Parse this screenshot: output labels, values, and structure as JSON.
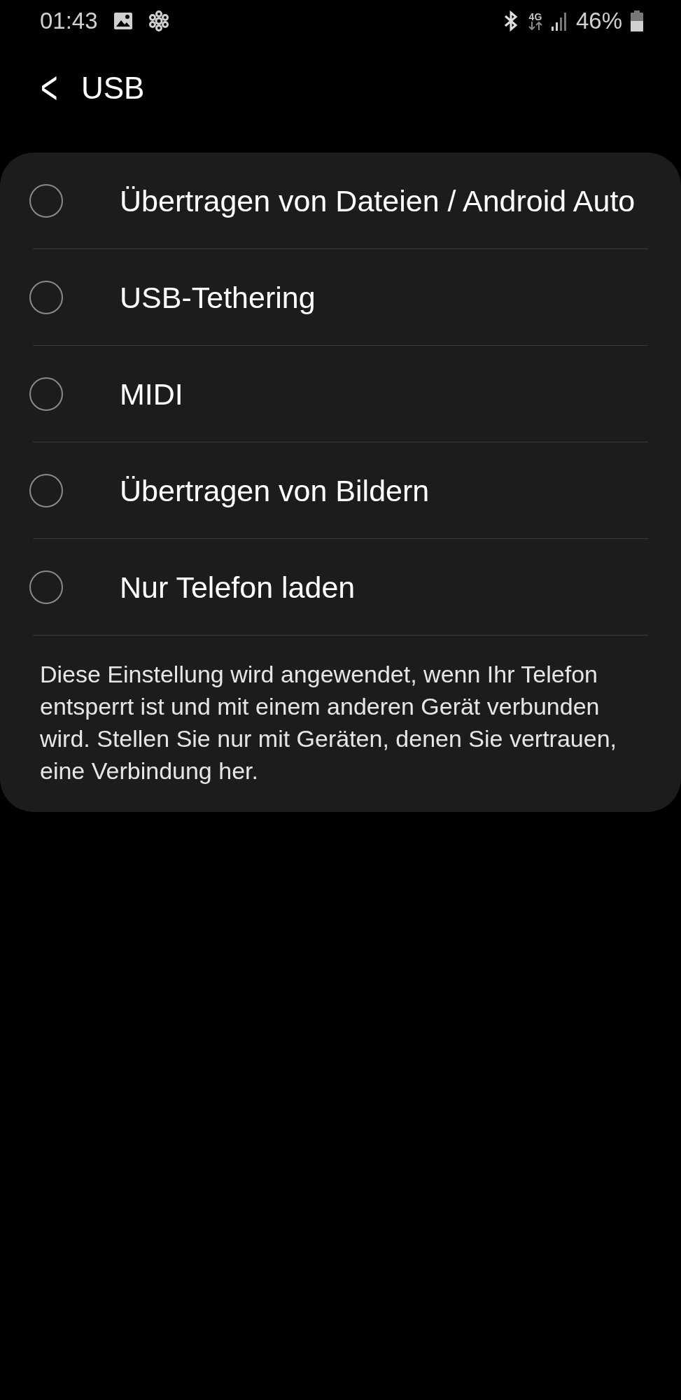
{
  "status_bar": {
    "time": "01:43",
    "network": "4G",
    "battery": "46%"
  },
  "header": {
    "back": "<",
    "title": "USB"
  },
  "options": [
    {
      "label": "Übertragen von Dateien / Android Auto",
      "selected": false
    },
    {
      "label": "USB-Tethering",
      "selected": false
    },
    {
      "label": "MIDI",
      "selected": false
    },
    {
      "label": "Übertragen von Bildern",
      "selected": false
    },
    {
      "label": "Nur Telefon laden",
      "selected": false
    }
  ],
  "description": "Diese Einstellung wird angewendet, wenn Ihr Telefon entsperrt ist und mit einem anderen Gerät verbunden wird. Stellen Sie nur mit Geräten, denen Sie vertrauen, eine Verbindung her."
}
